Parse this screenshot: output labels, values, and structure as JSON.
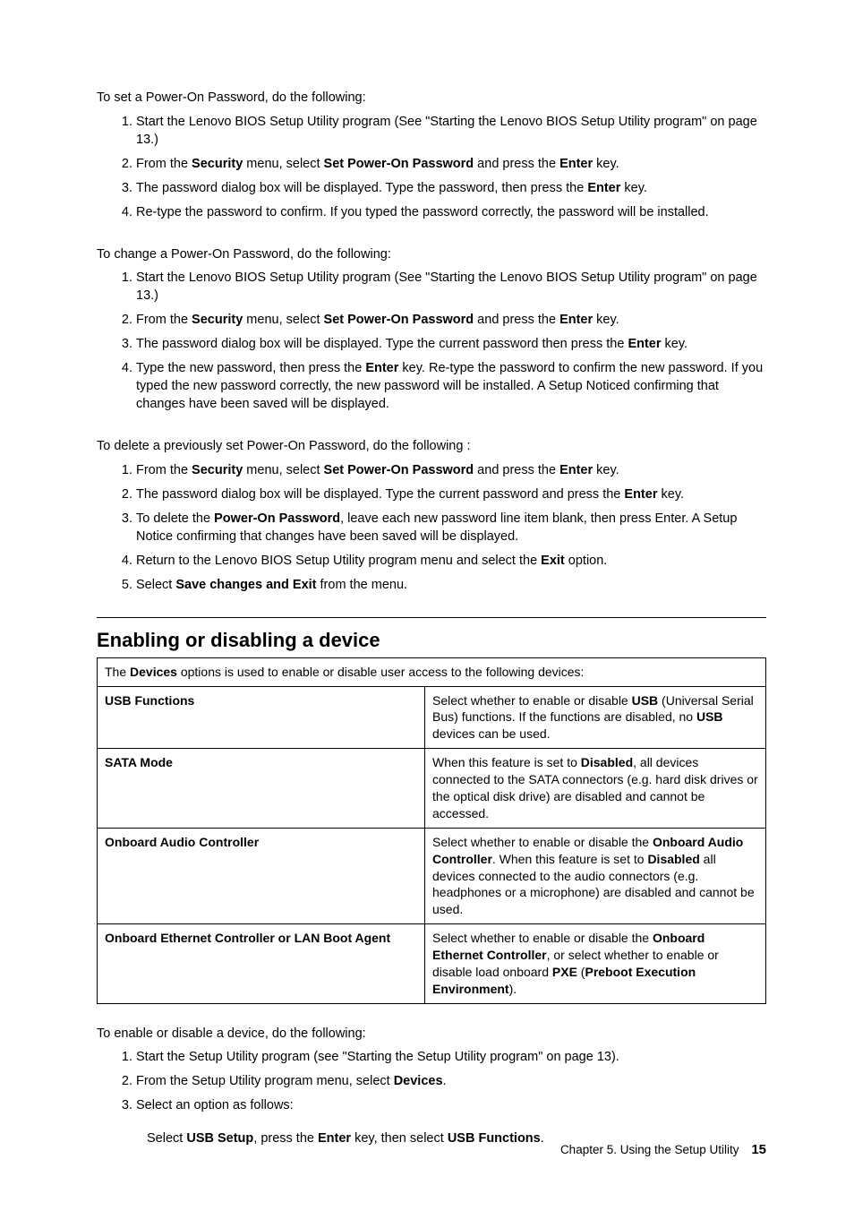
{
  "intro_set": "To set a Power-On Password, do the following:",
  "set_steps": [
    "Start the Lenovo BIOS Setup Utility program (See \"Starting the Lenovo BIOS Setup Utility program\" on page 13.)",
    "From the <b>Security</b> menu, select <b>Set Power-On Password</b> and press the <b>Enter</b> key.",
    "The password dialog box will be displayed. Type the password, then press the <b>Enter</b> key.",
    "Re-type the password to confirm. If you typed the password correctly, the password will be installed."
  ],
  "intro_change": "To change a Power-On Password, do the following:",
  "change_steps": [
    "Start the Lenovo BIOS Setup Utility program (See \"Starting the Lenovo BIOS Setup Utility program\" on page 13.)",
    "From the <b>Security</b> menu, select <b>Set Power-On Password</b> and press the <b>Enter</b> key.",
    "The password dialog box will be displayed. Type the current password then press the <b>Enter</b> key.",
    "Type the new password, then press the <b>Enter</b> key. Re-type the password to confirm the new password. If you typed the new password correctly, the new password will be installed. A Setup Noticed confirming that changes have been saved will be displayed."
  ],
  "intro_delete": "To delete a previously set Power-On Password, do the following :",
  "delete_steps": [
    "From the <b>Security</b> menu, select <b>Set Power-On Password</b> and press the <b>Enter</b> key.",
    "The password dialog box will be displayed. Type the current password and press the <b>Enter</b> key.",
    "To delete the <b>Power-On Password</b>, leave each new password line item blank, then press Enter. A Setup Notice confirming that changes have been saved will be displayed.",
    "Return to the Lenovo BIOS Setup Utility program menu and select the <b>Exit</b> option.",
    "Select <b>Save changes and Exit</b> from the menu."
  ],
  "heading_devices": "Enabling or disabling a device",
  "table_intro": "The <b>Devices</b> options is used to enable or disable user access to the following devices:",
  "table_rows": [
    {
      "name": "USB Functions",
      "desc": "Select whether to enable or disable <b>USB</b> (Universal Serial Bus) functions. If the functions are disabled, no <b>USB</b> devices can be used."
    },
    {
      "name": "SATA Mode",
      "desc": "When this feature is set to <b>Disabled</b>, all devices connected to the SATA connectors (e.g. hard disk drives or the optical disk drive) are disabled and cannot be accessed."
    },
    {
      "name": "Onboard Audio Controller",
      "desc": "Select whether to enable or disable the <b>Onboard Audio Controller</b>. When this feature is set to <b>Disabled</b> all devices connected to the audio connectors (e.g. headphones or a microphone) are disabled and cannot be used."
    },
    {
      "name": "Onboard Ethernet Controller or LAN Boot Agent",
      "desc": "Select whether to enable or disable the <b>Onboard Ethernet Controller</b>, or select whether to enable or disable load onboard <b>PXE</b> (<b>Preboot Execution Environment</b>)."
    }
  ],
  "intro_enable": "To enable or disable a device, do the following:",
  "enable_steps": [
    "Start the Setup Utility program (see \"Starting the Setup Utility program\" on page 13).",
    "From the Setup Utility program menu, select <b>Devices</b>.",
    "Select an option as follows:"
  ],
  "sub_step": "Select <b>USB Setup</b>, press the <b>Enter</b> key, then select <b>USB Functions</b>.",
  "footer_chapter": "Chapter 5. Using the Setup Utility",
  "footer_page": "15"
}
